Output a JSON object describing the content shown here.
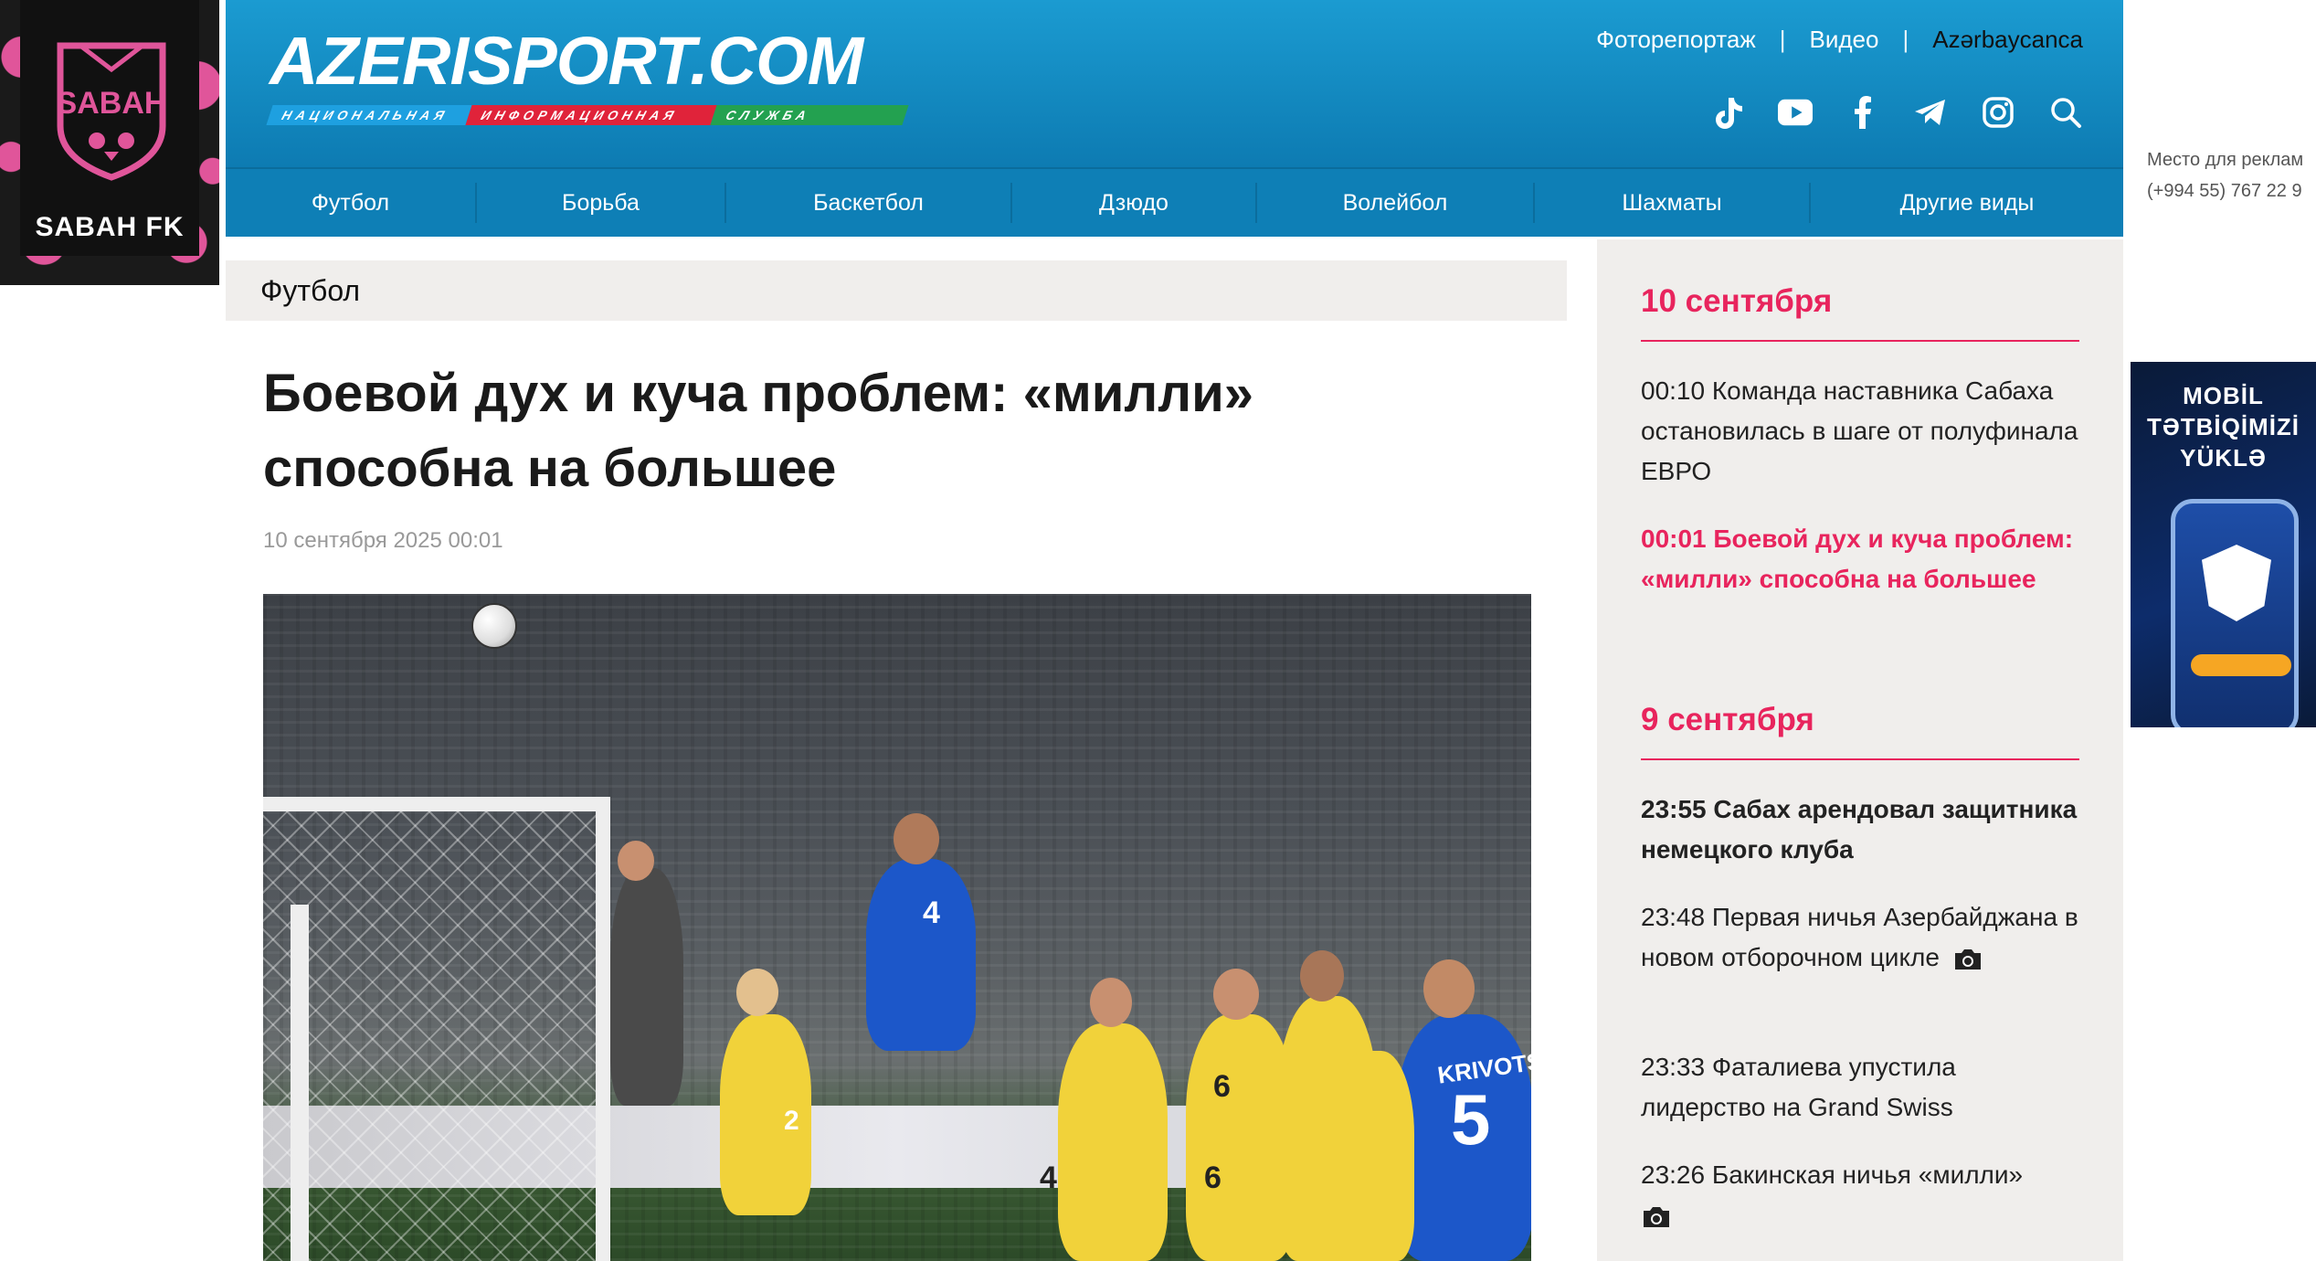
{
  "left_ad": {
    "brand": "SABAH",
    "club": "SABAH FK",
    "colors": {
      "pink": "#e0559a",
      "dark": "#111111"
    }
  },
  "header": {
    "logo": "AZERISPORT.COM",
    "tagline": [
      "НАЦИОНАЛЬНАЯ",
      "ИНФОРМАЦИОННАЯ",
      "СЛУЖБА"
    ],
    "top_links": [
      "Фоторепортаж",
      "Видео",
      "Azərbaycanca"
    ],
    "separator": "|",
    "social_icons": [
      "tiktok-icon",
      "youtube-icon",
      "facebook-icon",
      "telegram-icon",
      "instagram-icon",
      "search-icon"
    ],
    "colors": {
      "header_blue": "#1b9bd1",
      "nav_blue": "#0e7fb6"
    }
  },
  "nav": [
    "Футбол",
    "Борьба",
    "Баскетбол",
    "Дзюдо",
    "Волейбол",
    "Шахматы",
    "Другие виды"
  ],
  "right_ad": {
    "text_line1": "Место для реклам",
    "text_line2": "(+994 55) 767 22 9",
    "app_text": [
      "MOBİL",
      "TƏTBİQİMİZİ",
      "YÜKLƏ"
    ]
  },
  "article": {
    "breadcrumb": "Футбол",
    "title": "Боевой дух и куча проблем: «милли» способна на большее",
    "date": "10 сентября 2025 00:01",
    "player_numbers": [
      "4",
      "5",
      "2",
      "6",
      "6",
      "4"
    ],
    "jersey_name": "KRIVOTSYUK"
  },
  "sidebar": {
    "accent": "#e8245d",
    "days": [
      {
        "label": "10 сентября",
        "items": [
          {
            "text": "00:10 Команда наставника Сабаха остановилась в шаге от полуфинала ЕВРО"
          },
          {
            "text": "00:01 Боевой дух и куча проблем: «милли» способна на большее"
          }
        ]
      },
      {
        "label": "9 сентября",
        "items": [
          {
            "text": "23:55 Сабах арендовал защитника немецкого клуба"
          },
          {
            "text": "23:48 Первая ничья Азербайджана в новом отборочном цикле"
          },
          {
            "text": "23:33 Фаталиева упустила лидерство на Grand Swiss"
          },
          {
            "text": "23:26 Бакинская ничья «милли»"
          }
        ]
      }
    ]
  }
}
